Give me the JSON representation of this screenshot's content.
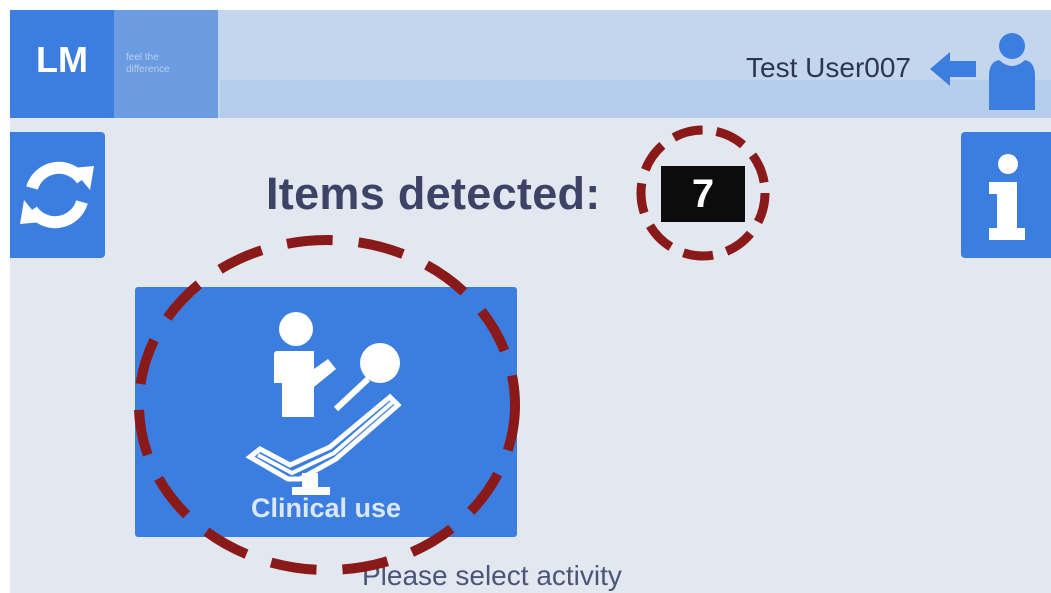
{
  "header": {
    "logo_text": "LM",
    "tagline_line1": "feel the",
    "tagline_line2": "difference",
    "username": "Test User007",
    "back_icon": "arrow-left-icon",
    "user_icon": "user-icon"
  },
  "sidebar": {
    "refresh_icon": "refresh-icon",
    "info_icon": "info-icon"
  },
  "main": {
    "items_label": "Items detected:",
    "items_count": "7",
    "activities": [
      {
        "label": "Clinical use",
        "icon": "dental-chair-icon"
      }
    ],
    "prompt": "Please select activity"
  },
  "annotations": {
    "color": "#8a1a1a",
    "style": "dashed-circle"
  },
  "colors": {
    "accent": "#3c7ee0",
    "background": "#e3e8f0",
    "header": "#c4d6ee",
    "text": "#3d4366"
  }
}
